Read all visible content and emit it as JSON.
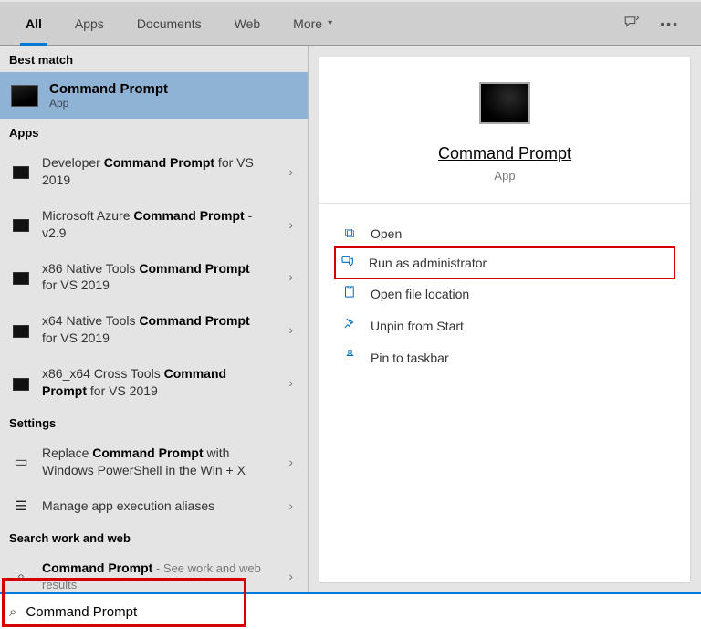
{
  "tabs": {
    "all": "All",
    "apps": "Apps",
    "documents": "Documents",
    "web": "Web",
    "more": "More"
  },
  "left": {
    "best_match_label": "Best match",
    "best_match_title": "Command Prompt",
    "best_match_sub": "App",
    "apps_label": "Apps",
    "app_items": [
      {
        "pre": "Developer ",
        "bold": "Command Prompt",
        "post": " for VS 2019"
      },
      {
        "pre": "Microsoft Azure ",
        "bold": "Command Prompt",
        "post": " - v2.9"
      },
      {
        "pre": "x86 Native Tools ",
        "bold": "Command Prompt",
        "post": " for VS 2019"
      },
      {
        "pre": "x64 Native Tools ",
        "bold": "Command Prompt",
        "post": " for VS 2019"
      },
      {
        "pre": "x86_x64 Cross Tools ",
        "bold": "Command Prompt",
        "post": " for VS 2019"
      }
    ],
    "settings_label": "Settings",
    "settings_items": [
      {
        "pre": "Replace ",
        "bold": "Command Prompt",
        "post": " with Windows PowerShell in the Win + X"
      },
      {
        "pre": "Manage app execution aliases",
        "bold": "",
        "post": ""
      }
    ],
    "web_label": "Search work and web",
    "web_item": {
      "bold": "Command Prompt",
      "post": " - See work and web results"
    }
  },
  "right": {
    "title": "Command Prompt",
    "sub": "App",
    "actions": {
      "open": "Open",
      "runadmin": "Run as administrator",
      "openloc": "Open file location",
      "unpin": "Unpin from Start",
      "pintask": "Pin to taskbar"
    }
  },
  "search": {
    "value": "Command Prompt"
  }
}
